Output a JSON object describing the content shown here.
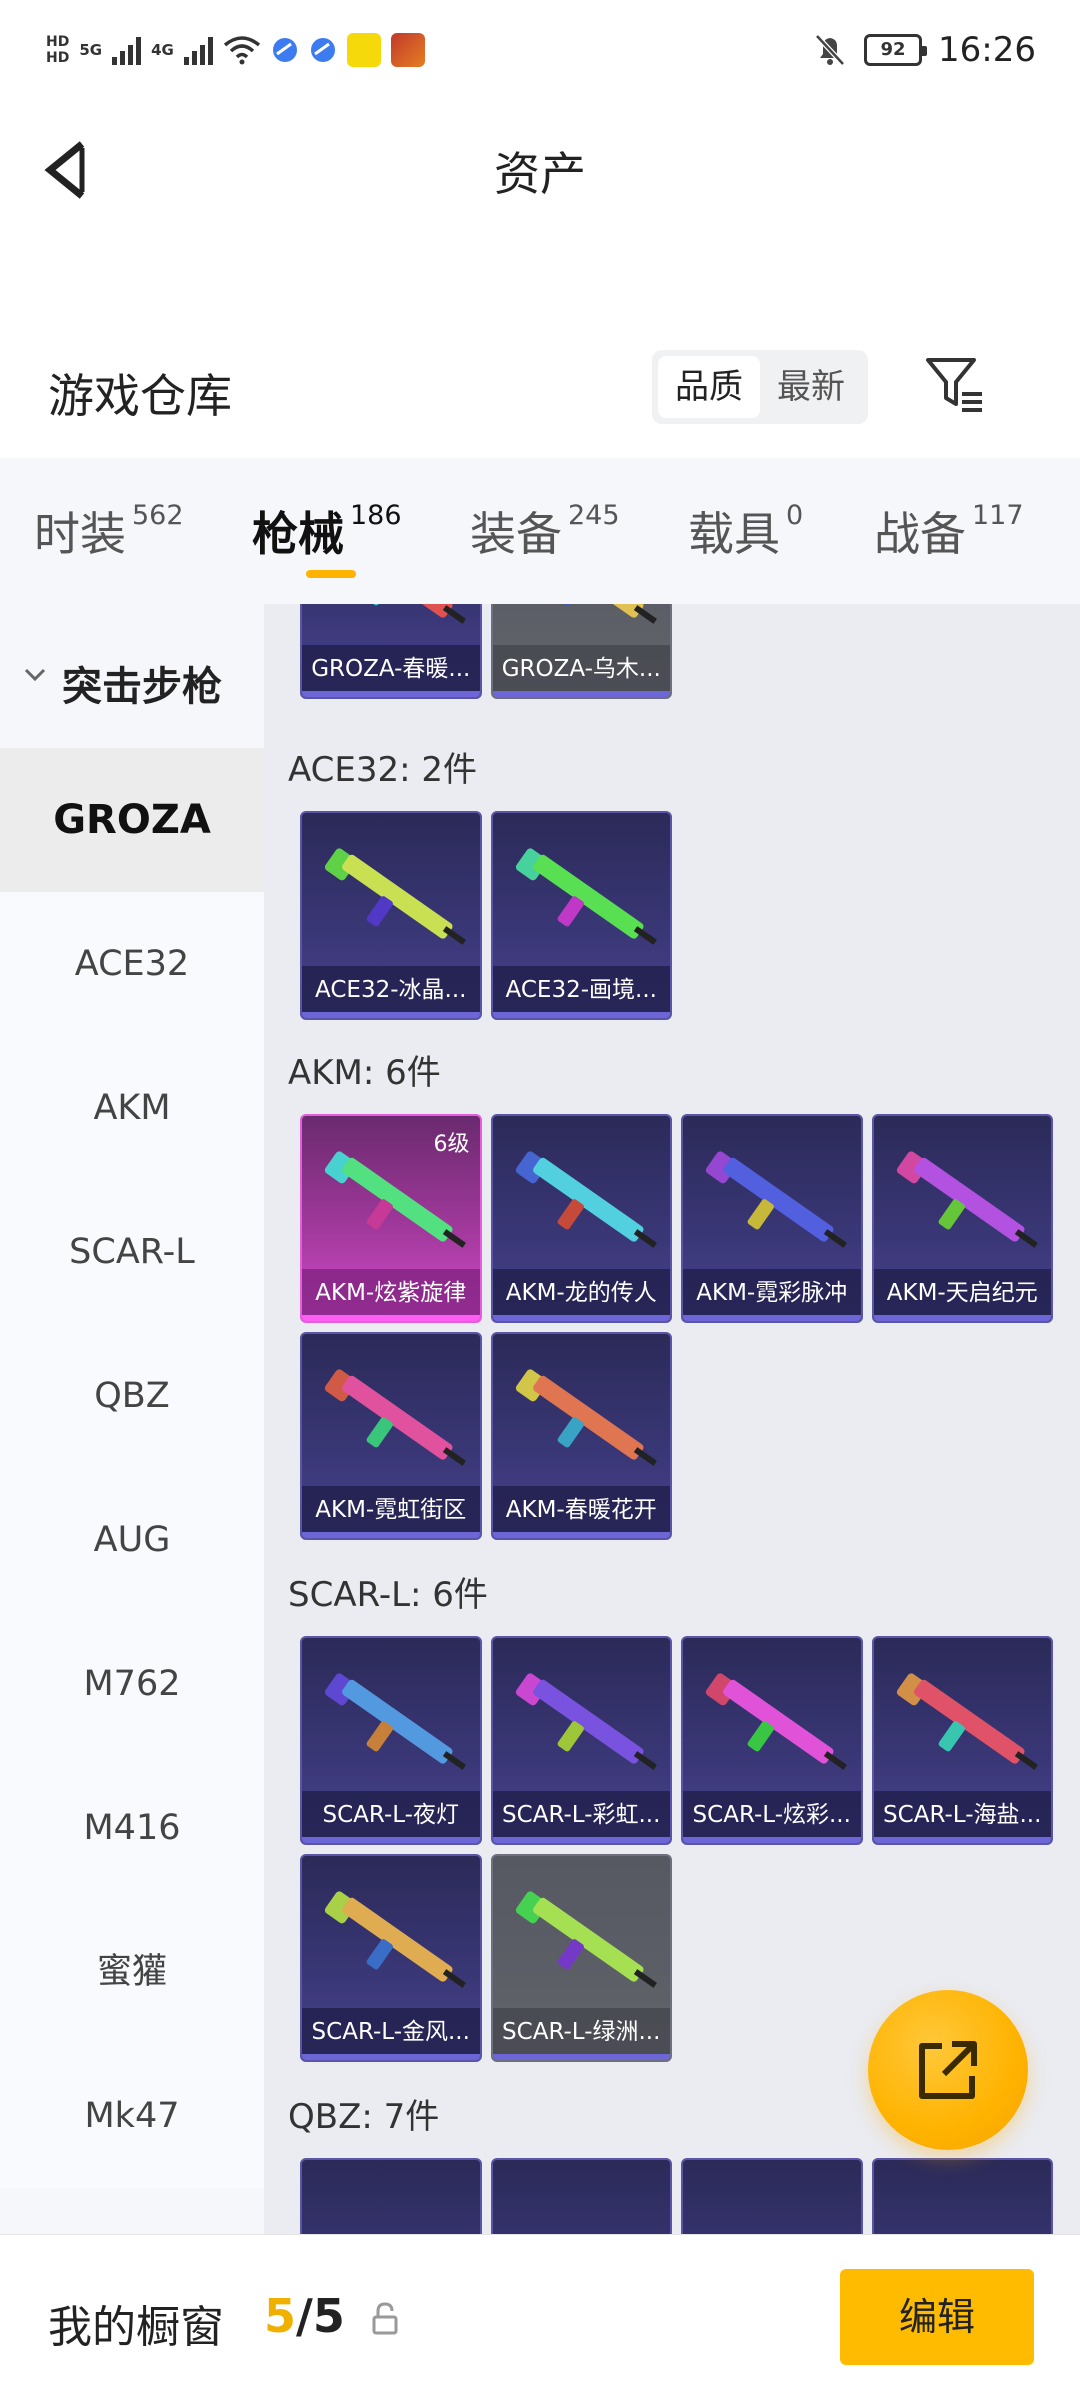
{
  "status_bar": {
    "hd1": "HD",
    "hd2": "HD",
    "net1": "5G",
    "net2": "4G",
    "battery": "92",
    "time": "16:26"
  },
  "header": {
    "title": "资产"
  },
  "warehouse": {
    "title": "游戏仓库",
    "sort_options": [
      "品质",
      "最新"
    ],
    "active_sort": "品质"
  },
  "tabs": [
    {
      "label": "时装",
      "count": "562"
    },
    {
      "label": "枪械",
      "count": "186",
      "active": true
    },
    {
      "label": "装备",
      "count": "245"
    },
    {
      "label": "载具",
      "count": "0"
    },
    {
      "label": "战备",
      "count": "117"
    }
  ],
  "sidebar": {
    "category": "突击步枪",
    "items": [
      "GROZA",
      "ACE32",
      "AKM",
      "SCAR-L",
      "QBZ",
      "AUG",
      "M762",
      "M416",
      "蜜獾",
      "Mk47"
    ],
    "active": "GROZA"
  },
  "sections": [
    {
      "title": "",
      "items": [
        {
          "name": "GROZA-春暖...",
          "style": "purple"
        },
        {
          "name": "GROZA-乌木...",
          "style": "gray"
        }
      ]
    },
    {
      "title": "ACE32: 2件",
      "items": [
        {
          "name": "ACE32-冰晶...",
          "style": "purple"
        },
        {
          "name": "ACE32-画境...",
          "style": "purple"
        }
      ]
    },
    {
      "title": "AKM: 6件",
      "items": [
        {
          "name": "AKM-炫紫旋律",
          "style": "pink",
          "level": "6级"
        },
        {
          "name": "AKM-龙的传人",
          "style": "purple"
        },
        {
          "name": "AKM-霓彩脉冲",
          "style": "purple"
        },
        {
          "name": "AKM-天启纪元",
          "style": "purple"
        },
        {
          "name": "AKM-霓虹街区",
          "style": "purple"
        },
        {
          "name": "AKM-春暖花开",
          "style": "purple"
        }
      ]
    },
    {
      "title": "SCAR-L: 6件",
      "items": [
        {
          "name": "SCAR-L-夜灯",
          "style": "purple"
        },
        {
          "name": "SCAR-L-彩虹...",
          "style": "purple"
        },
        {
          "name": "SCAR-L-炫彩...",
          "style": "purple"
        },
        {
          "name": "SCAR-L-海盐...",
          "style": "purple"
        },
        {
          "name": "SCAR-L-金风...",
          "style": "purple"
        },
        {
          "name": "SCAR-L-绿洲...",
          "style": "gray"
        }
      ]
    },
    {
      "title": "QBZ: 7件",
      "items": []
    }
  ],
  "bottom_bar": {
    "label": "我的橱窗",
    "current": "5",
    "total": "5",
    "edit_label": "编辑"
  },
  "colors": {
    "accent": "#ffbb00",
    "card_purple": "#3a3777",
    "card_gray": "#5e6068",
    "card_pink": "#a63aa0"
  },
  "icons": {
    "back": "chevron-left-icon",
    "filter": "filter-icon",
    "fab": "share-external-icon",
    "lock": "lock-icon"
  }
}
